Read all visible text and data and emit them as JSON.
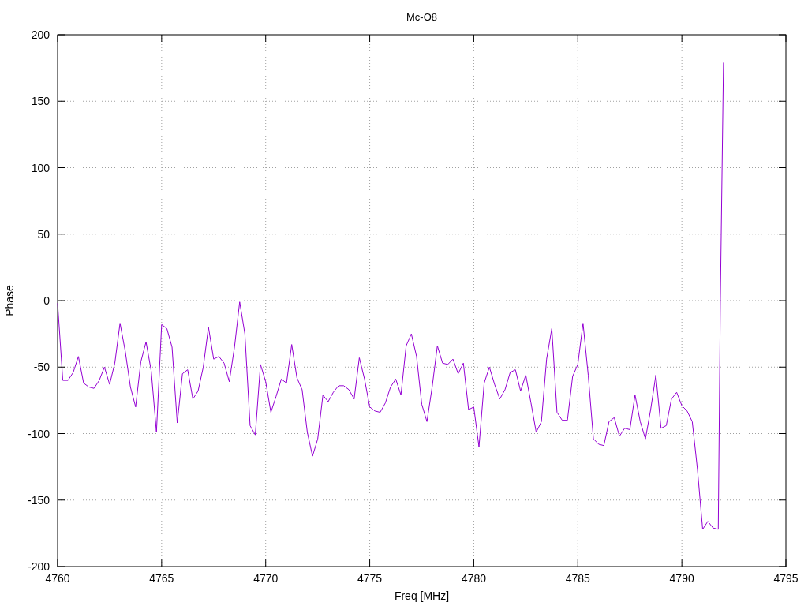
{
  "chart_data": {
    "type": "line",
    "grid": true,
    "title": "Mc-O8",
    "xlabel": "Freq [MHz]",
    "ylabel": "Phase",
    "xlim": [
      4760,
      4795
    ],
    "ylim": [
      -200,
      200
    ],
    "xticks": [
      4760,
      4765,
      4770,
      4775,
      4780,
      4785,
      4790,
      4795
    ],
    "yticks": [
      -200,
      -150,
      -100,
      -50,
      0,
      50,
      100,
      150,
      200
    ],
    "x": [
      4760,
      4760.25,
      4760.5,
      4760.75,
      4761,
      4761.25,
      4761.5,
      4761.75,
      4762,
      4762.25,
      4762.5,
      4762.75,
      4763,
      4763.25,
      4763.5,
      4763.75,
      4764,
      4764.25,
      4764.5,
      4764.75,
      4765,
      4765.25,
      4765.5,
      4765.75,
      4766,
      4766.25,
      4766.5,
      4766.75,
      4767,
      4767.25,
      4767.5,
      4767.75,
      4768,
      4768.25,
      4768.5,
      4768.75,
      4769,
      4769.25,
      4769.5,
      4769.75,
      4770,
      4770.25,
      4770.5,
      4770.75,
      4771,
      4771.25,
      4771.5,
      4771.75,
      4772,
      4772.25,
      4772.5,
      4772.75,
      4773,
      4773.25,
      4773.5,
      4773.75,
      4774,
      4774.25,
      4774.5,
      4774.75,
      4775,
      4775.25,
      4775.5,
      4775.75,
      4776,
      4776.25,
      4776.5,
      4776.75,
      4777,
      4777.25,
      4777.5,
      4777.75,
      4778,
      4778.25,
      4778.5,
      4778.75,
      4779,
      4779.25,
      4779.5,
      4779.75,
      4780,
      4780.25,
      4780.5,
      4780.75,
      4781,
      4781.25,
      4781.5,
      4781.75,
      4782,
      4782.25,
      4782.5,
      4782.75,
      4783,
      4783.25,
      4783.5,
      4783.75,
      4784,
      4784.25,
      4784.5,
      4784.75,
      4785,
      4785.25,
      4785.5,
      4785.75,
      4786,
      4786.25,
      4786.5,
      4786.75,
      4787,
      4787.25,
      4787.5,
      4787.75,
      4788,
      4788.25,
      4788.5,
      4788.75,
      4789,
      4789.25,
      4789.5,
      4789.75,
      4790,
      4790.25,
      4790.5,
      4790.75,
      4791,
      4791.25,
      4791.5,
      4791.75,
      4791.85,
      4792
    ],
    "series": [
      {
        "color": "#9400d3",
        "values": [
          -2,
          -60,
          -60,
          -54,
          -42,
          -62,
          -65,
          -66,
          -60,
          -50,
          -63,
          -47,
          -17,
          -38,
          -65,
          -80,
          -46,
          -31,
          -53,
          -99,
          -18,
          -21,
          -35,
          -92,
          -55,
          -52,
          -74,
          -68,
          -50,
          -20,
          -44,
          -42,
          -47,
          -61,
          -35,
          -1,
          -25,
          -94,
          -101,
          -48,
          -61,
          -84,
          -72,
          -59,
          -62,
          -33,
          -58,
          -67,
          -99,
          -117,
          -104,
          -71,
          -76,
          -69,
          -64,
          -64,
          -67,
          -74,
          -43,
          -59,
          -80,
          -83,
          -84,
          -77,
          -65,
          -59,
          -71,
          -34,
          -25,
          -42,
          -78,
          -91,
          -65,
          -34,
          -47,
          -48,
          -44,
          -55,
          -47,
          -82,
          -80,
          -110,
          -62,
          -50,
          -63,
          -74,
          -67,
          -54,
          -52,
          -68,
          -56,
          -77,
          -99,
          -91,
          -44,
          -21,
          -84,
          -90,
          -90,
          -57,
          -48,
          -17,
          -56,
          -104,
          -108,
          -109,
          -91,
          -88,
          -102,
          -96,
          -97,
          -71,
          -91,
          -104,
          -82,
          -56,
          -96,
          -94,
          -74,
          -69,
          -79,
          -83,
          -91,
          -127,
          -172,
          -166,
          -171,
          -172,
          0,
          179
        ]
      }
    ]
  }
}
